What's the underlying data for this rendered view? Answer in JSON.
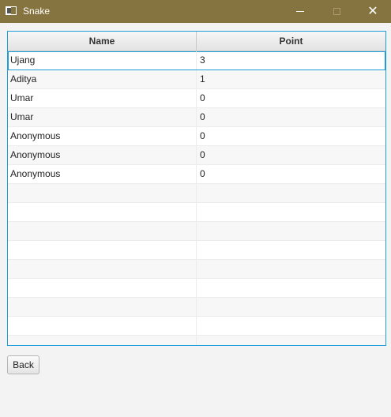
{
  "window": {
    "title": "Snake",
    "minimize_symbol": "—",
    "close_symbol": "✕"
  },
  "table": {
    "columns": [
      "Name",
      "Point"
    ],
    "rows": [
      {
        "name": "Ujang",
        "point": "3"
      },
      {
        "name": "Aditya",
        "point": "1"
      },
      {
        "name": "Umar",
        "point": "0"
      },
      {
        "name": "Umar",
        "point": "0"
      },
      {
        "name": "Anonymous",
        "point": "0"
      },
      {
        "name": "Anonymous",
        "point": "0"
      },
      {
        "name": "Anonymous",
        "point": "0"
      }
    ],
    "selected_row": 0
  },
  "buttons": {
    "back_label": "Back"
  },
  "colors": {
    "titlebar": "#85743f",
    "focus_border": "#1e9ed8"
  }
}
